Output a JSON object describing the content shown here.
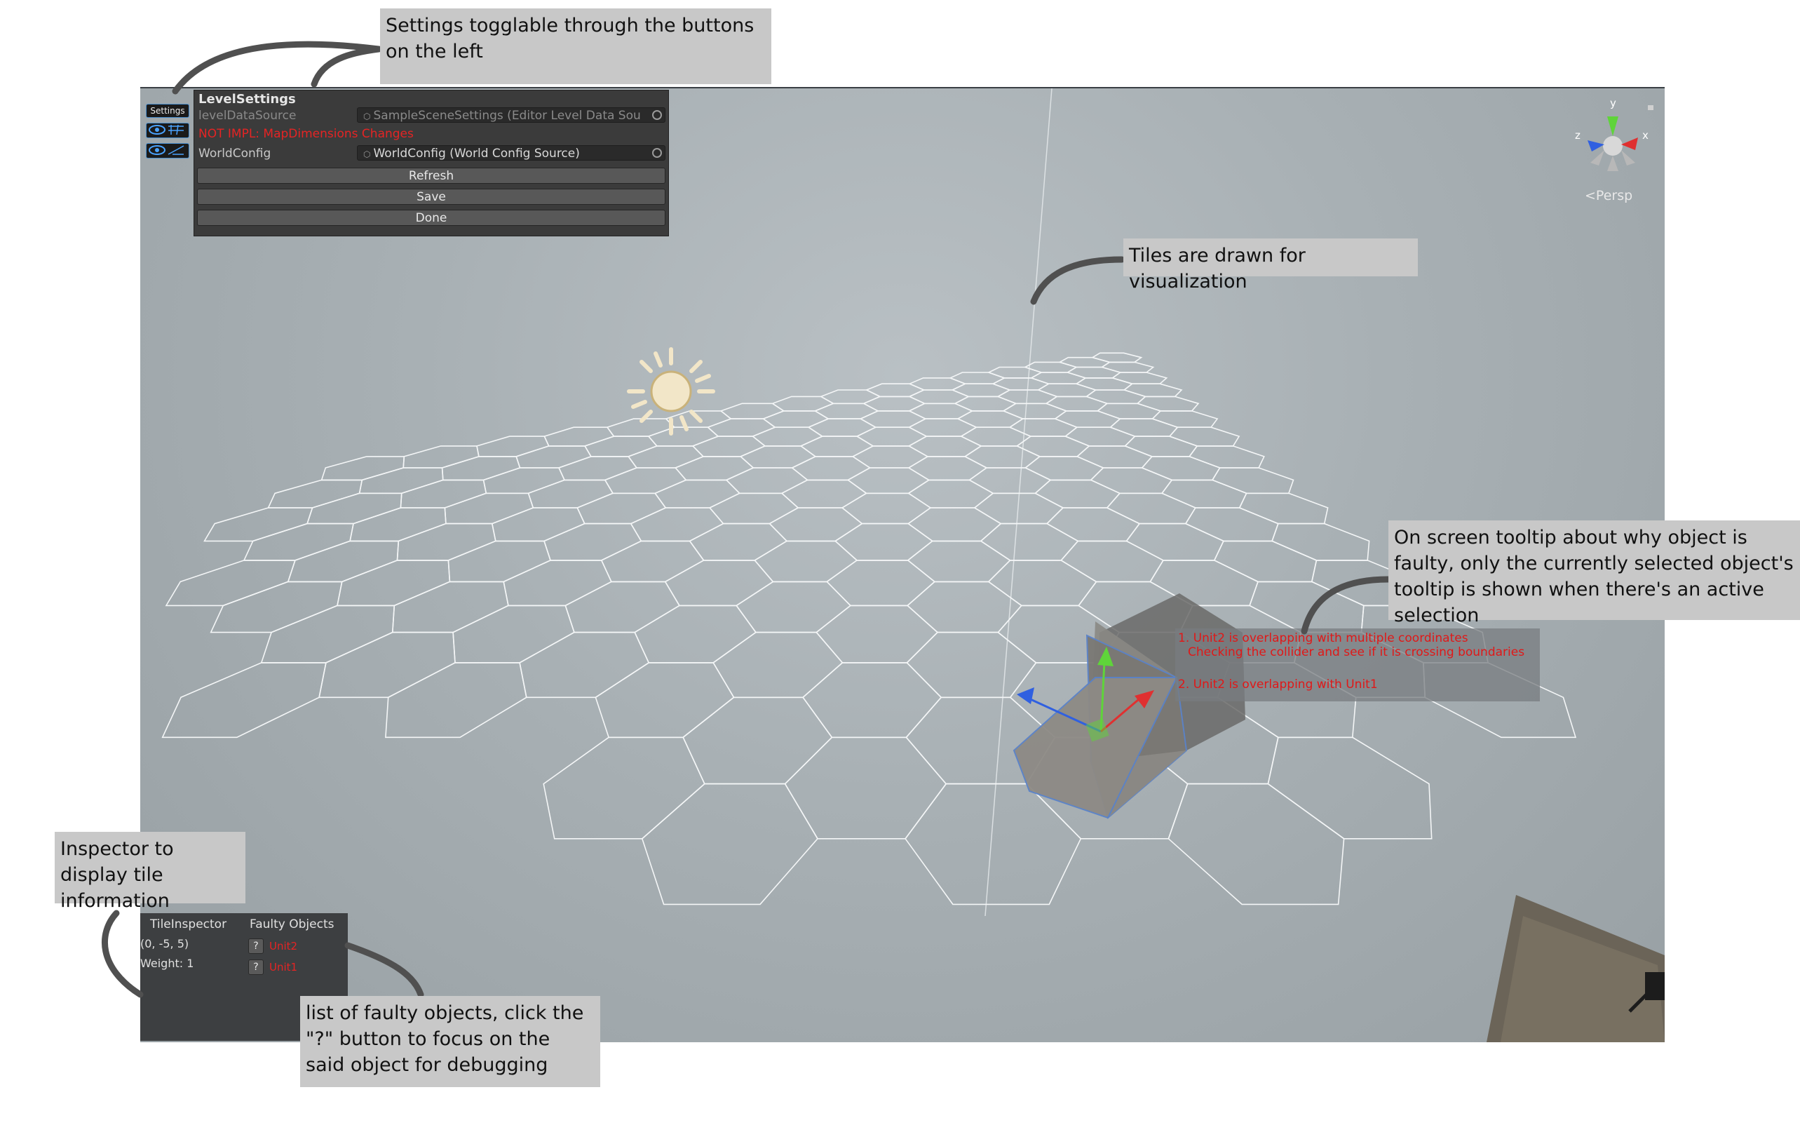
{
  "level_settings": {
    "title": "LevelSettings",
    "level_data_source_label": "levelDataSource",
    "level_data_source_value": "SampleSceneSettings (Editor Level Data Sou",
    "error": "NOT IMPL: MapDimensions Changes",
    "world_config_label": "WorldConfig",
    "world_config_value": "WorldConfig (World Config Source)",
    "buttons": [
      "Refresh",
      "Save",
      "Done"
    ]
  },
  "toggles": {
    "settings_label": "Settings"
  },
  "gizmo": {
    "y": "y",
    "x": "x",
    "z": "z",
    "persp": "<Persp"
  },
  "inspector": {
    "title": "TileInspector",
    "coords": "(0, -5, 5)",
    "weight": "Weight: 1"
  },
  "faulty": {
    "title": "Faulty Objects",
    "buttons": [
      "?",
      "?"
    ],
    "items": [
      "Unit2",
      "Unit1"
    ]
  },
  "tooltip": {
    "line1": "1. Unit2 is overlapping with multiple coordinates",
    "line2": "Checking the collider and see if it is crossing boundaries",
    "line3": "2. Unit2 is overlapping with Unit1"
  },
  "callouts": {
    "settings": "Settings togglable through the buttons on the left",
    "tiles": "Tiles are drawn for visualization",
    "tooltip": "On screen tooltip about why object is faulty, only the currently selected object's tooltip is shown when there's an active selection",
    "inspector": "Inspector to display tile information",
    "faulty": "list of faulty objects, click the \"?\" button to focus on the said object for debugging"
  },
  "colors": {
    "error": "#e52424",
    "panel": "#3b3b3b",
    "callout_bg": "#c8c8c8",
    "axis_x": "#e03030",
    "axis_y": "#5fd43a",
    "axis_z": "#3060e0"
  }
}
